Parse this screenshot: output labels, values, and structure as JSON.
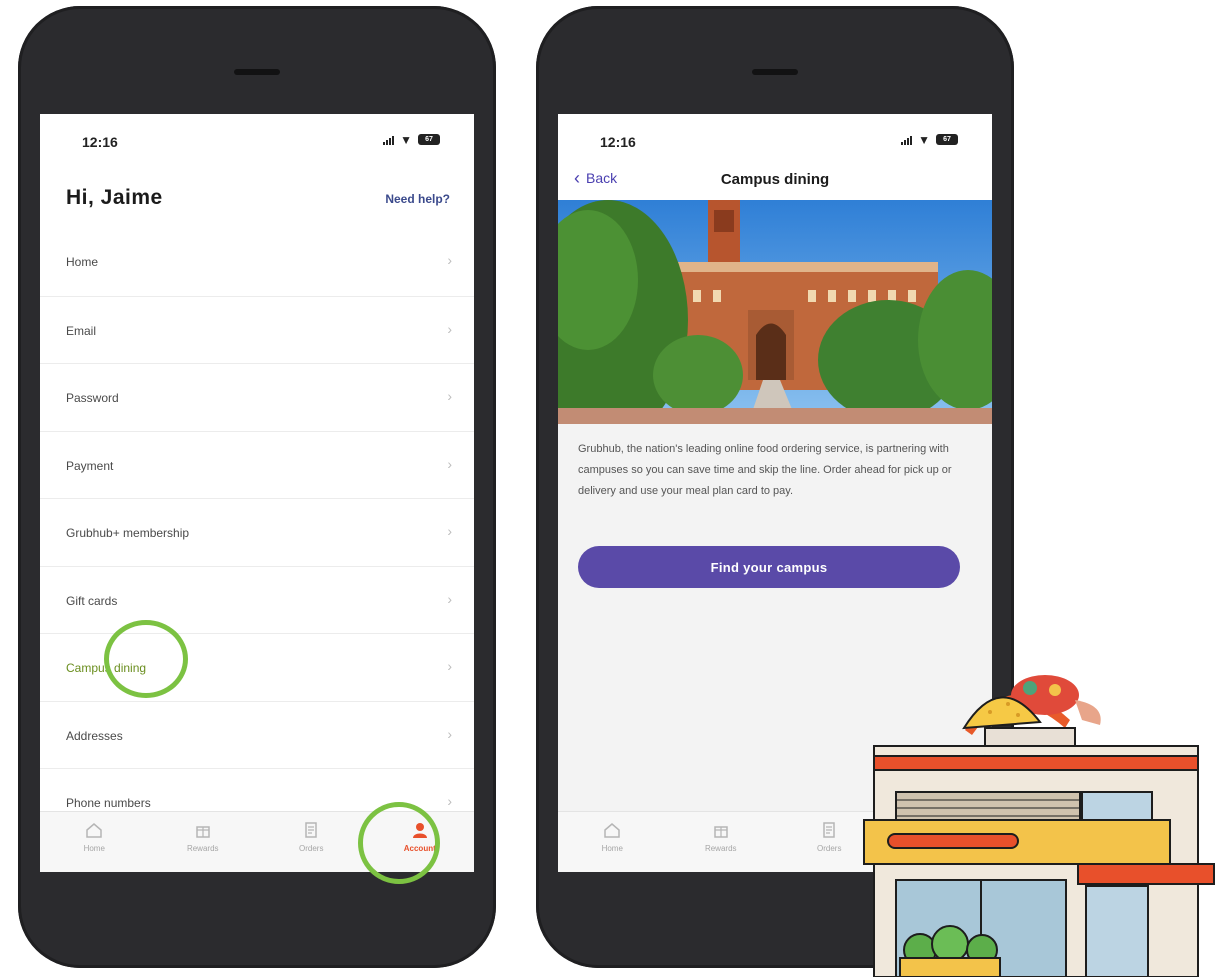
{
  "phone1": {
    "status": {
      "time": "12:16",
      "battery": "67"
    },
    "greeting": "Hi, Jaime",
    "help_link": "Need help?",
    "menu": [
      {
        "label": "Home"
      },
      {
        "label": "Email"
      },
      {
        "label": "Password"
      },
      {
        "label": "Payment"
      },
      {
        "label": "Grubhub+ membership"
      },
      {
        "label": "Gift cards"
      },
      {
        "label": "Campus dining"
      },
      {
        "label": "Addresses"
      },
      {
        "label": "Phone numbers"
      }
    ],
    "tabs": [
      {
        "label": "Home",
        "icon": "home-icon"
      },
      {
        "label": "Rewards",
        "icon": "rewards-icon"
      },
      {
        "label": "Orders",
        "icon": "orders-icon"
      },
      {
        "label": "Account",
        "icon": "account-icon",
        "active": true
      }
    ]
  },
  "phone2": {
    "status": {
      "time": "12:16",
      "battery": "67"
    },
    "back_label": "Back",
    "title": "Campus dining",
    "description": "Grubhub, the nation's leading online food ordering service, is partnering with campuses so you can save time and skip the line. Order ahead for pick up or delivery and use your meal plan card to pay.",
    "cta_label": "Find your campus",
    "tabs": [
      {
        "label": "Home",
        "icon": "home-icon"
      },
      {
        "label": "Rewards",
        "icon": "rewards-icon"
      },
      {
        "label": "Orders",
        "icon": "orders-icon"
      }
    ]
  },
  "colors": {
    "accent_purple": "#5a4aa8",
    "highlight_green": "#7cc242",
    "active_orange": "#e8502b",
    "phone_body": "#2b2b2e"
  }
}
